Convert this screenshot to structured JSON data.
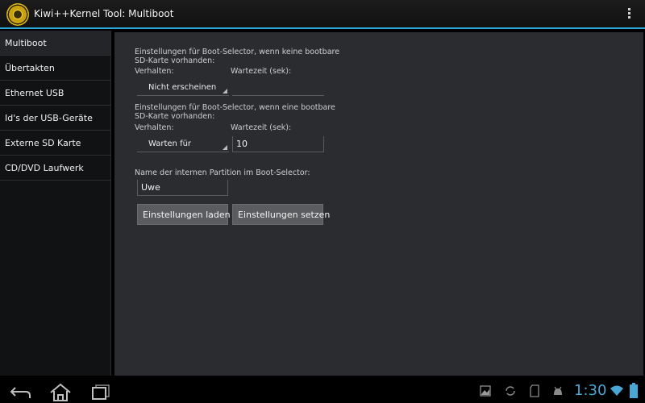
{
  "app": {
    "title": "Kiwi++Kernel Tool: Multiboot",
    "icon": "app-logo-icon",
    "accent_color": "#2aa8d8"
  },
  "sidebar": {
    "items": [
      {
        "label": "Multiboot",
        "active": true
      },
      {
        "label": "Übertakten",
        "active": false
      },
      {
        "label": "Ethernet USB",
        "active": false
      },
      {
        "label": "Id's der USB-Geräte",
        "active": false
      },
      {
        "label": "Externe SD Karte",
        "active": false
      },
      {
        "label": "CD/DVD Laufwerk",
        "active": false
      }
    ]
  },
  "section_no_sd": {
    "heading_line1": "Einstellungen für Boot-Selector, wenn keine bootbare",
    "heading_line2": "SD-Karte vorhanden:",
    "behavior_label": "Verhalten:",
    "behavior_value": "Nicht erscheinen",
    "wait_label": "Wartezeit (sek):",
    "wait_value": ""
  },
  "section_sd": {
    "heading_line1": "Einstellungen für Boot-Selector, wenn eine bootbare",
    "heading_line2": "SD-Karte vorhanden:",
    "behavior_label": "Verhalten:",
    "behavior_value": "Warten für",
    "wait_label": "Wartezeit (sek):",
    "wait_value": "10"
  },
  "partition": {
    "label": "Name der internen Partition im Boot-Selector:",
    "value": "Uwe"
  },
  "buttons": {
    "load": "Einstellungen laden",
    "set": "Einstellungen setzen"
  },
  "system_bar": {
    "clock": "1:30",
    "nav_icons": [
      "back-icon",
      "home-icon",
      "recent-apps-icon"
    ],
    "status_icons": [
      "gallery-notification-icon",
      "sync-icon",
      "sd-card-icon",
      "android-debug-icon",
      "wifi-icon",
      "battery-icon"
    ],
    "clock_color": "#49a7d6"
  }
}
